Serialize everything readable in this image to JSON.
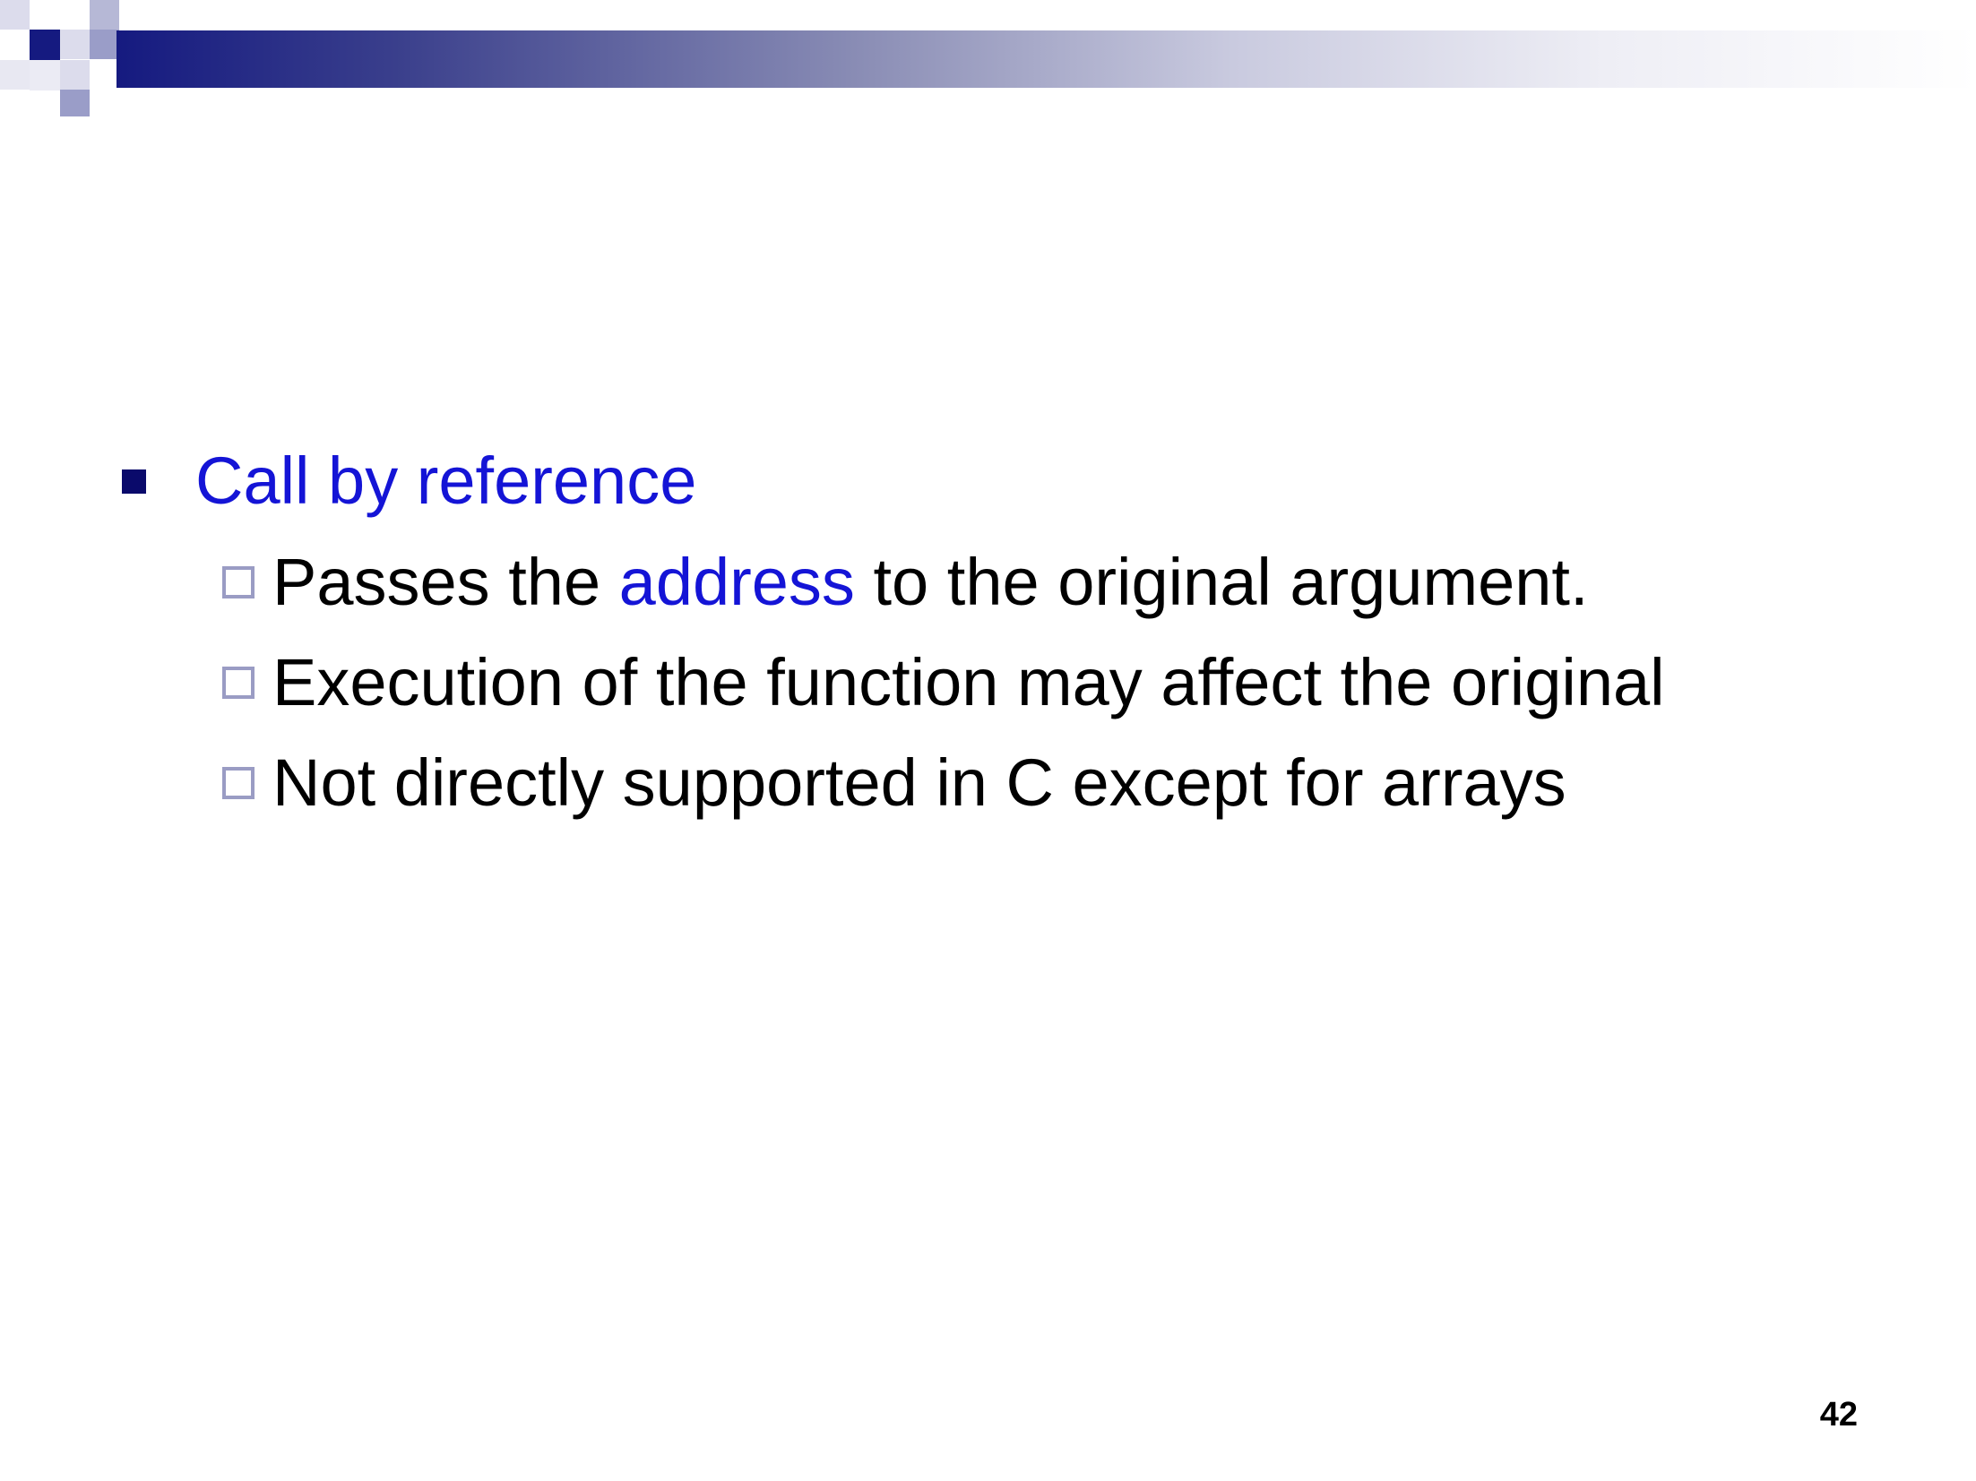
{
  "slide": {
    "bullet_main": "Call by reference",
    "sub_bullets": [
      {
        "before": "Passes the ",
        "highlight": "address",
        "after": " to the original argument."
      },
      {
        "before": "Execution of the function may affect the original",
        "highlight": "",
        "after": ""
      },
      {
        "before": "Not directly supported in C except for arrays",
        "highlight": "",
        "after": ""
      }
    ],
    "page_number": "42"
  },
  "colors": {
    "highlight_text": "#1414d6",
    "header_dark": "#151a80",
    "bullet_main": "#0a0a6b",
    "bullet_sub_border": "#9a9cc4"
  },
  "icons": {
    "main_bullet": "filled-square-icon",
    "sub_bullet": "hollow-square-icon"
  }
}
